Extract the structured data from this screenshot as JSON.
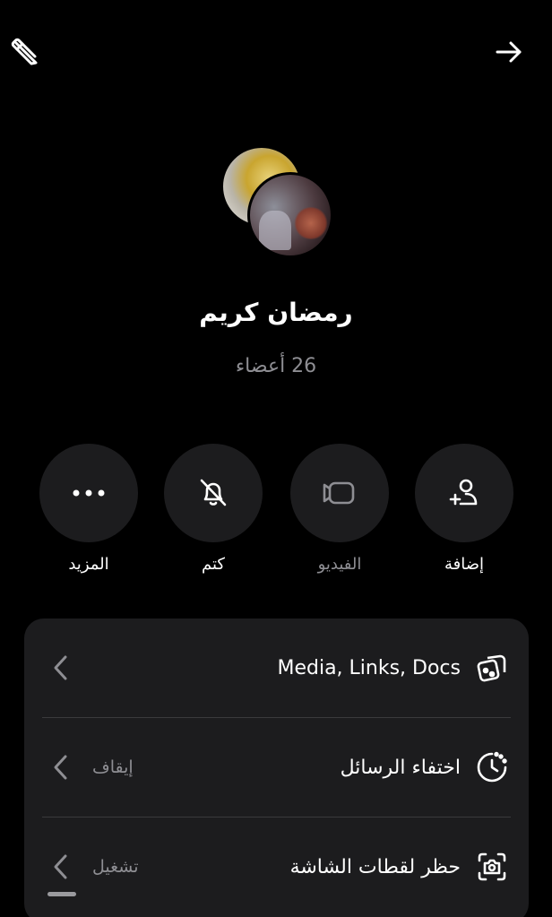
{
  "group": {
    "name": "رمضان كريم",
    "members": "26 أعضاء"
  },
  "header": {
    "left_icon": "pencil-icon",
    "right_icon": "arrow-right-icon"
  },
  "actions": [
    {
      "label": "المزيد",
      "icon": "more-dots-icon"
    },
    {
      "label": "كتم",
      "icon": "bell-mute-icon"
    },
    {
      "label": "الفيديو",
      "icon": "video-icon"
    },
    {
      "label": "إضافة",
      "icon": "add-person-icon"
    }
  ],
  "rows": [
    {
      "title": "Media, Links, Docs",
      "value": "",
      "icon": "media-icon"
    },
    {
      "title": "اختفاء الرسائل",
      "value": "إيقاف",
      "icon": "timer-icon"
    },
    {
      "title": "حظر لقطات الشاشة",
      "value": "تشغيل",
      "icon": "screenshot-block-icon"
    }
  ],
  "colors": {
    "background": "#000000",
    "surface": "#1c1c1e",
    "muted_text": "#8e8e93",
    "divider": "#3a3a3c"
  }
}
